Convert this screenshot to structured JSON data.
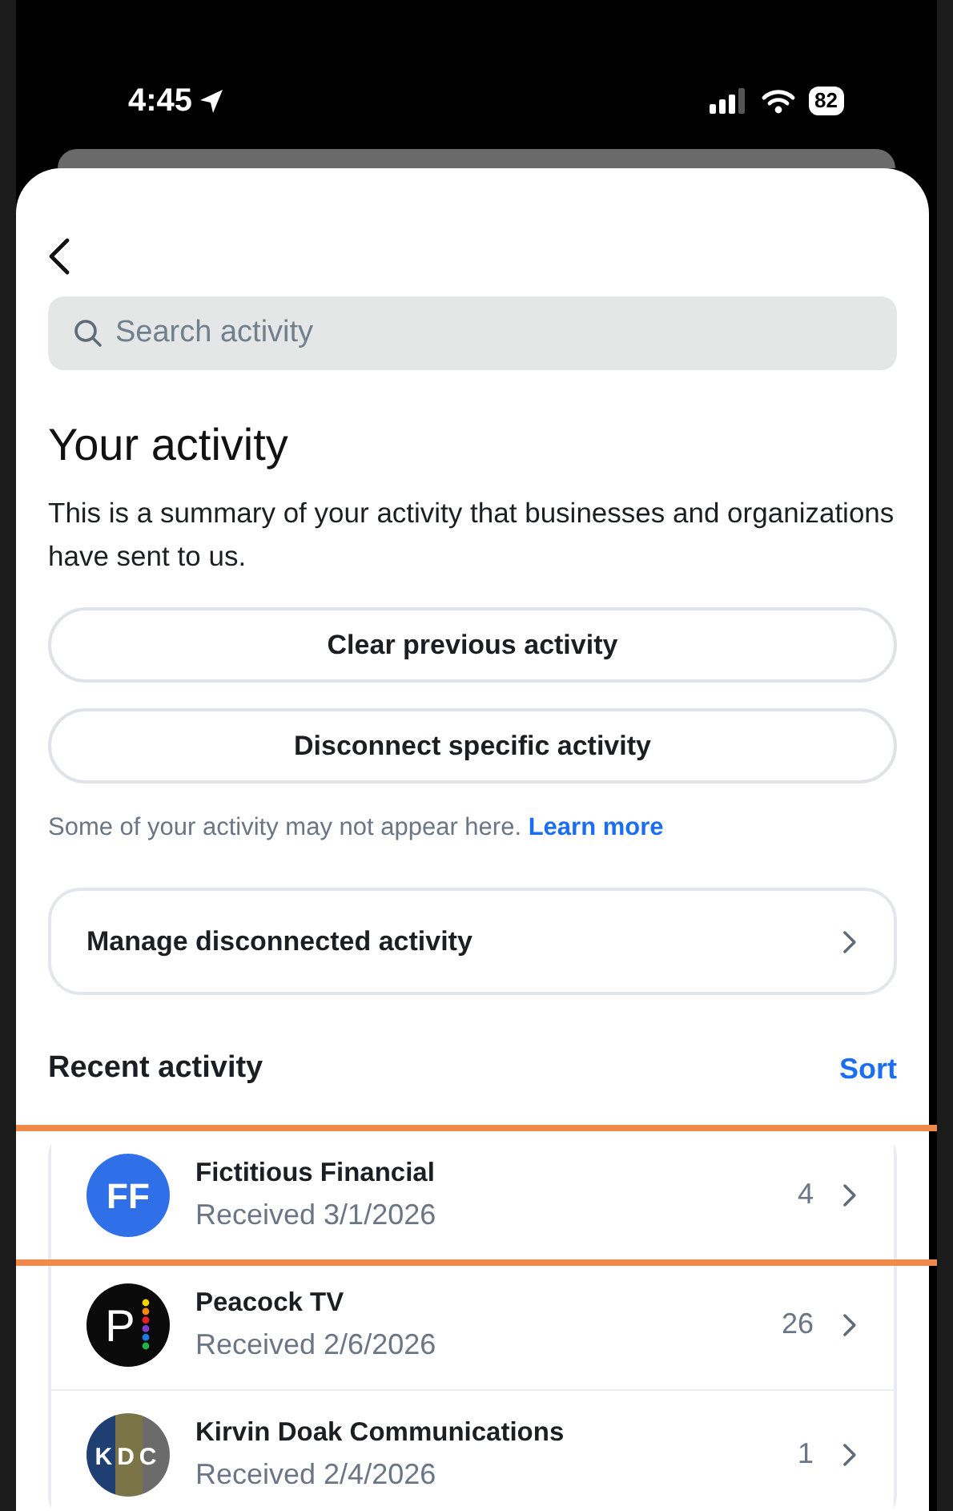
{
  "status_bar": {
    "time": "4:45",
    "battery": "82"
  },
  "search": {
    "placeholder": "Search activity"
  },
  "title": "Your activity",
  "description": "This is a summary of your activity that businesses and organizations have sent to us.",
  "buttons": [
    "Clear previous activity",
    "Disconnect specific activity"
  ],
  "note": {
    "text": "Some of your activity may not appear here.",
    "link": "Learn more"
  },
  "manage": {
    "label": "Manage disconnected activity"
  },
  "recent": {
    "heading": "Recent activity",
    "sort": "Sort"
  },
  "activities": [
    {
      "name": "Fictitious Financial",
      "received": "Received 3/1/2026",
      "count": "4",
      "highlighted": true,
      "logo": {
        "kind": "monogram",
        "text": "FF",
        "color": "#2f6fe8"
      }
    },
    {
      "name": "Peacock TV",
      "received": "Received 2/6/2026",
      "count": "26",
      "highlighted": false,
      "logo": {
        "kind": "dots",
        "text": "P",
        "color": "#0a0a0a"
      }
    },
    {
      "name": "Kirvin Doak Communications",
      "received": "Received 2/4/2026",
      "count": "1",
      "highlighted": false,
      "logo": {
        "kind": "stripes",
        "text": "KDC",
        "color": "#1f3f73"
      }
    }
  ]
}
